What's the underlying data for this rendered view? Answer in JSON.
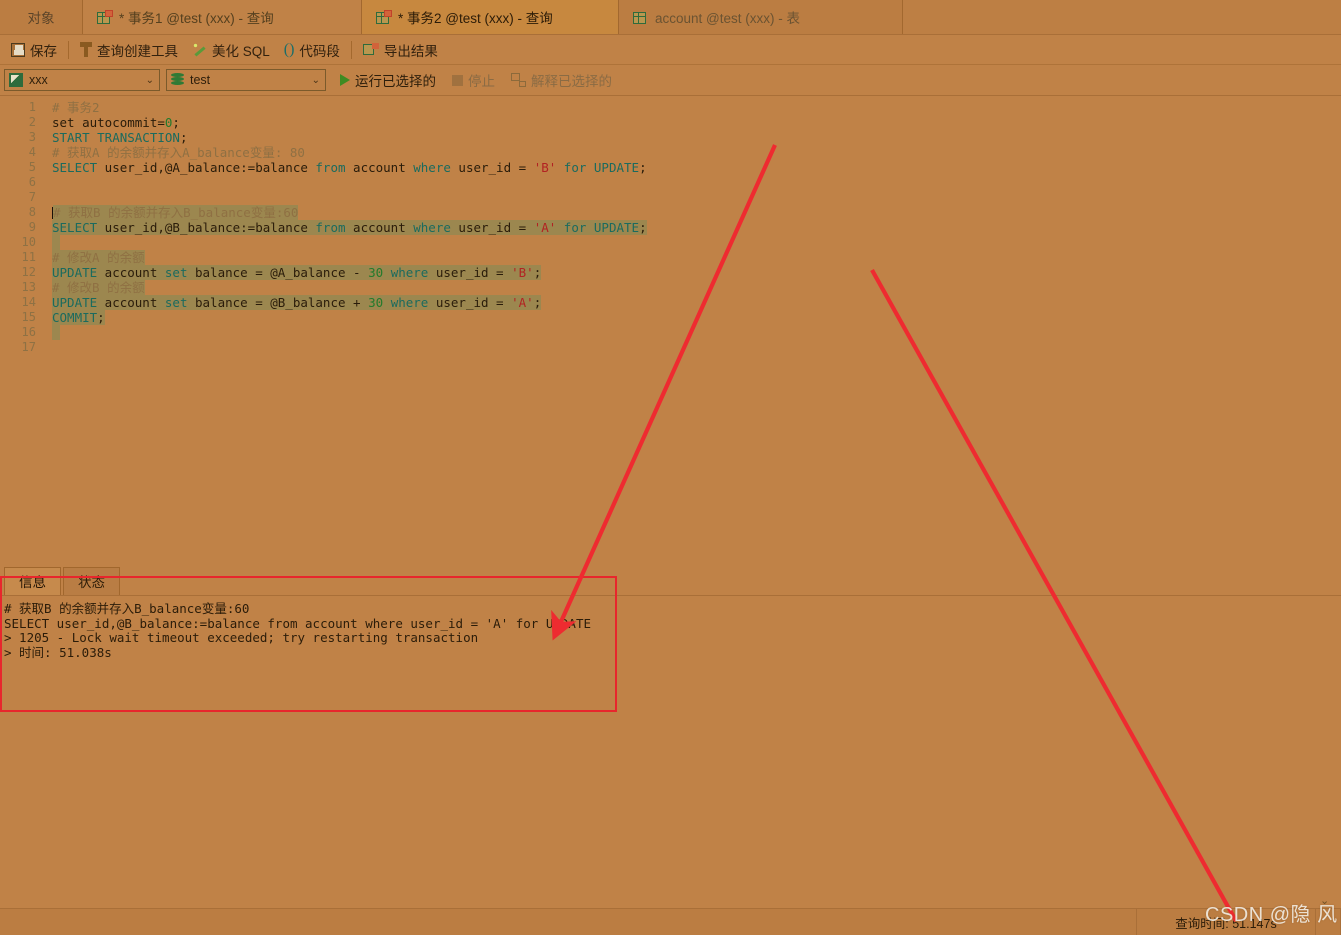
{
  "tabbar": {
    "object_tab": "对象",
    "tabs": [
      {
        "label": "* 事务1 @test (xxx) - 查询",
        "icon": "query-grid-icon",
        "active": false,
        "modified": true
      },
      {
        "label": "* 事务2 @test (xxx) - 查询",
        "icon": "query-grid-icon",
        "active": true,
        "modified": true
      },
      {
        "label": "account @test (xxx) - 表",
        "icon": "table-grid-icon",
        "active": false,
        "modified": false
      }
    ]
  },
  "toolbar": {
    "save_label": "保存",
    "query_builder_label": "查询创建工具",
    "beautify_label": "美化 SQL",
    "snippet_label": "代码段",
    "export_label": "导出结果",
    "icons": {
      "save": "save-icon",
      "builder": "query-builder-icon",
      "beautify": "magic-wand-icon",
      "snippet": "parentheses-icon",
      "export": "export-grid-icon"
    }
  },
  "connbar": {
    "connection_value": "xxx",
    "database_value": "test",
    "run_selected_label": "运行已选择的",
    "stop_label": "停止",
    "explain_selected_label": "解释已选择的",
    "chevron": "⌄"
  },
  "editor": {
    "lines": [
      {
        "n": 1,
        "tokens": [
          {
            "t": "cmt",
            "s": "# 事务2"
          }
        ]
      },
      {
        "n": 2,
        "tokens": [
          {
            "t": "txt",
            "s": "set autocommit="
          },
          {
            "t": "num",
            "s": "0"
          },
          {
            "t": "txt",
            "s": ";"
          }
        ]
      },
      {
        "n": 3,
        "tokens": [
          {
            "t": "kw",
            "s": "START TRANSACTION"
          },
          {
            "t": "txt",
            "s": ";"
          }
        ]
      },
      {
        "n": 4,
        "tokens": [
          {
            "t": "cmt",
            "s": "# 获取A 的余额并存入A_balance变量: 80"
          }
        ]
      },
      {
        "n": 5,
        "tokens": [
          {
            "t": "kw",
            "s": "SELECT"
          },
          {
            "t": "txt",
            "s": " user_id,@A_balance:=balance "
          },
          {
            "t": "kw",
            "s": "from"
          },
          {
            "t": "txt",
            "s": " account "
          },
          {
            "t": "kw",
            "s": "where"
          },
          {
            "t": "txt",
            "s": " user_id = "
          },
          {
            "t": "str",
            "s": "'B'"
          },
          {
            "t": "txt",
            "s": " "
          },
          {
            "t": "kw",
            "s": "for UPDATE"
          },
          {
            "t": "txt",
            "s": ";"
          }
        ]
      },
      {
        "n": 6,
        "tokens": []
      },
      {
        "n": 7,
        "tokens": []
      },
      {
        "n": 8,
        "sel": true,
        "caret": true,
        "tokens": [
          {
            "t": "cmt",
            "s": "# 获取B 的余额并存入B_balance变量:60"
          }
        ]
      },
      {
        "n": 9,
        "sel": true,
        "tokens": [
          {
            "t": "kw",
            "s": "SELECT"
          },
          {
            "t": "txt",
            "s": " user_id,@B_balance:=balance "
          },
          {
            "t": "kw",
            "s": "from"
          },
          {
            "t": "txt",
            "s": " account "
          },
          {
            "t": "kw",
            "s": "where"
          },
          {
            "t": "txt",
            "s": " user_id = "
          },
          {
            "t": "str",
            "s": "'A'"
          },
          {
            "t": "txt",
            "s": " "
          },
          {
            "t": "kw",
            "s": "for UPDATE"
          },
          {
            "t": "txt",
            "s": ";"
          }
        ]
      },
      {
        "n": 10,
        "sel": true,
        "tokens": [
          {
            "t": "txt",
            "s": " "
          }
        ]
      },
      {
        "n": 11,
        "sel": true,
        "tokens": [
          {
            "t": "cmt",
            "s": "# 修改A 的余额"
          }
        ]
      },
      {
        "n": 12,
        "sel": true,
        "tokens": [
          {
            "t": "kw",
            "s": "UPDATE"
          },
          {
            "t": "txt",
            "s": " account "
          },
          {
            "t": "kw",
            "s": "set"
          },
          {
            "t": "txt",
            "s": " balance = @A_balance - "
          },
          {
            "t": "num",
            "s": "30"
          },
          {
            "t": "txt",
            "s": " "
          },
          {
            "t": "kw",
            "s": "where"
          },
          {
            "t": "txt",
            "s": " user_id = "
          },
          {
            "t": "str",
            "s": "'B'"
          },
          {
            "t": "txt",
            "s": ";"
          }
        ]
      },
      {
        "n": 13,
        "sel": true,
        "tokens": [
          {
            "t": "cmt",
            "s": "# 修改B 的余额"
          }
        ]
      },
      {
        "n": 14,
        "sel": true,
        "tokens": [
          {
            "t": "kw",
            "s": "UPDATE"
          },
          {
            "t": "txt",
            "s": " account "
          },
          {
            "t": "kw",
            "s": "set"
          },
          {
            "t": "txt",
            "s": " balance = @B_balance + "
          },
          {
            "t": "num",
            "s": "30"
          },
          {
            "t": "txt",
            "s": " "
          },
          {
            "t": "kw",
            "s": "where"
          },
          {
            "t": "txt",
            "s": " user_id = "
          },
          {
            "t": "str",
            "s": "'A'"
          },
          {
            "t": "txt",
            "s": ";"
          }
        ]
      },
      {
        "n": 15,
        "sel": true,
        "tokens": [
          {
            "t": "kw",
            "s": "COMMIT"
          },
          {
            "t": "txt",
            "s": ";"
          }
        ]
      },
      {
        "n": 16,
        "sel": true,
        "tokens": [
          {
            "t": "txt",
            "s": " "
          }
        ]
      },
      {
        "n": 17,
        "tokens": []
      }
    ]
  },
  "results": {
    "tabs": [
      {
        "label": "信息",
        "active": true
      },
      {
        "label": "状态",
        "active": false
      }
    ],
    "log_lines": [
      "# 获取B 的余额并存入B_balance变量:60",
      "SELECT user_id,@B_balance:=balance from account where user_id = 'A' for UPDATE",
      "> 1205 - Lock wait timeout exceeded; try restarting transaction",
      "> 时间: 51.038s"
    ]
  },
  "statusbar": {
    "query_time_label": "查询时间: 51.147s",
    "chevron": "⌄"
  },
  "annotations": {
    "watermark": "CSDN @隐 风",
    "arrow_color": "#ee2b30",
    "highlight_box_color": "#e8262c"
  },
  "theme": {
    "background": "#c08247",
    "selection": "#9c874f",
    "keyword": "#1b6b5e",
    "comment": "#8f7043",
    "string": "#b22222",
    "number": "#237a2c"
  }
}
